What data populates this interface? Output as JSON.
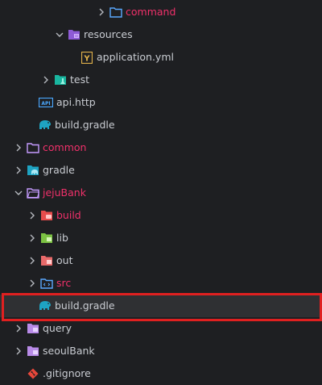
{
  "tree": {
    "items": [
      {
        "label": "command",
        "color": "#f0306a"
      },
      {
        "label": "resources",
        "color": "#c9ccd2"
      },
      {
        "label": "application.yml",
        "color": "#c9ccd2"
      },
      {
        "label": "test",
        "color": "#c9ccd2"
      },
      {
        "label": "api.http",
        "color": "#c9ccd2"
      },
      {
        "label": "build.gradle",
        "color": "#c9ccd2"
      },
      {
        "label": "common",
        "color": "#f0306a"
      },
      {
        "label": "gradle",
        "color": "#c9ccd2"
      },
      {
        "label": "jejuBank",
        "color": "#f0306a"
      },
      {
        "label": "build",
        "color": "#f0306a"
      },
      {
        "label": "lib",
        "color": "#c9ccd2"
      },
      {
        "label": "out",
        "color": "#c9ccd2"
      },
      {
        "label": "src",
        "color": "#f0306a"
      },
      {
        "label": "build.gradle",
        "color": "#c9ccd2",
        "selected": true
      },
      {
        "label": "query",
        "color": "#c9ccd2"
      },
      {
        "label": "seoulBank",
        "color": "#c9ccd2"
      },
      {
        "label": ".gitignore",
        "color": "#c9ccd2"
      }
    ]
  },
  "yml_icon_letter": "Y",
  "http_icon_text": "API"
}
